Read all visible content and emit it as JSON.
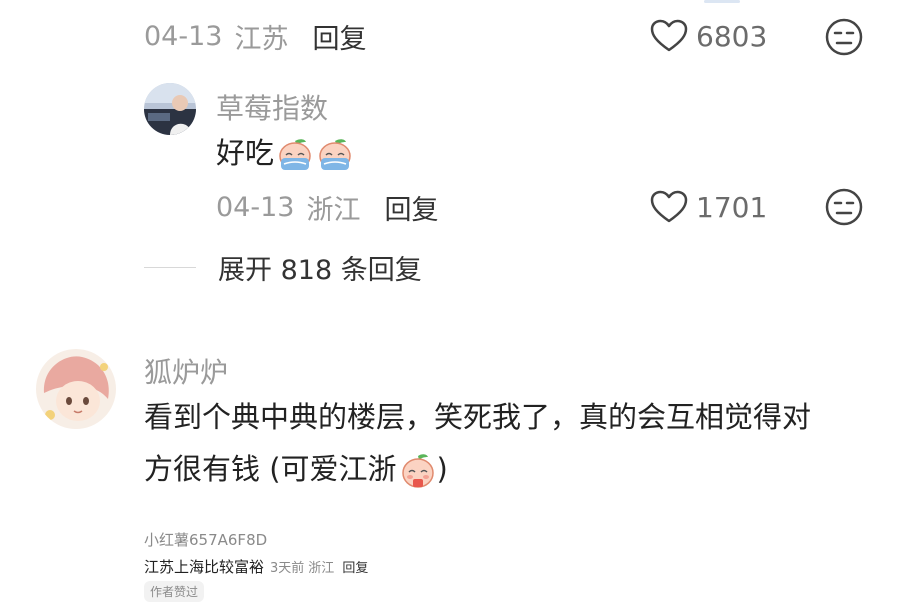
{
  "comment_top": {
    "date": "04-13",
    "location": "江苏",
    "reply_label": "回复",
    "likes": "6803"
  },
  "reply1": {
    "username": "草莓指数",
    "text": "好吃",
    "date": "04-13",
    "location": "浙江",
    "reply_label": "回复",
    "likes": "1701",
    "expand_label": "展开 818 条回复"
  },
  "comment2": {
    "username": "狐炉炉",
    "line1": "看到个典中典的楼层，笑死我了，真的会互相觉得对",
    "line2": "方很有钱 (可爱江浙",
    "line2_end": ")"
  },
  "sub_reply": {
    "username": "小红薯657A6F8D",
    "text": "江苏上海比较富裕",
    "time": "3天前",
    "location": "浙江",
    "reply_label": "回复",
    "author_tag": "作者赞过"
  },
  "icons": {
    "heart": "heart-icon",
    "neutral_face": "neutral-face-icon",
    "crying_peach": "crying-peach-emoji",
    "cute_peach": "cute-peach-emoji"
  },
  "colors": {
    "meta_gray": "#9a9a9a",
    "text_dark": "#222222",
    "emoji_blue": "#7fb6e6",
    "emoji_peach": "#f6b8a2",
    "emoji_red": "#e8574c"
  }
}
